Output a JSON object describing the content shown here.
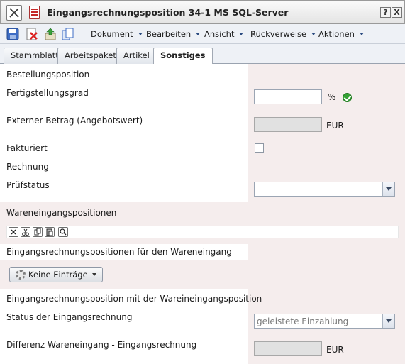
{
  "window": {
    "title": "Eingangsrechnungsposition 34-1 MS SQL-Server",
    "help_label": "?",
    "close_label": "X"
  },
  "toolbar": {
    "icons": [
      "save-icon",
      "delete-icon",
      "export-icon",
      "copy-icon"
    ],
    "menus": [
      "Dokument",
      "Bearbeiten",
      "Ansicht",
      "Rückverweise",
      "Aktionen"
    ]
  },
  "tabs": [
    {
      "label": "Stammblatt",
      "active": false
    },
    {
      "label": "Arbeitspaket",
      "active": false
    },
    {
      "label": "Artikel",
      "active": false
    },
    {
      "label": "Sonstiges",
      "active": true
    }
  ],
  "form": {
    "bestellungsposition_label": "Bestellungsposition",
    "fertigstellungsgrad": {
      "label": "Fertigstellungsgrad",
      "value": "",
      "unit": "%"
    },
    "externer_betrag": {
      "label": "Externer Betrag (Angebotswert)",
      "value": "",
      "unit": "EUR"
    },
    "fakturiert": {
      "label": "Fakturiert",
      "checked": false
    },
    "rechnung_label": "Rechnung",
    "pruefstatus": {
      "label": "Prüfstatus",
      "value": ""
    },
    "wareneingang_label": "Wareneingangspositionen",
    "grid_icons": [
      "delete-icon",
      "cut-icon",
      "copy-icon",
      "paste-icon",
      "search-icon"
    ],
    "er_positionen_label": "Eingangsrechnungspositionen für den Wareneingang",
    "keine_eintraege": "Keine Einträge",
    "er_position_we_label": "Eingangsrechnungsposition mit der Wareineingangsposition",
    "status_rechnung": {
      "label": "Status der Eingangsrechnung",
      "value": "geleistete Einzahlung"
    },
    "differenz": {
      "label": "Differenz Wareneingang - Eingangsrechnung",
      "value": "",
      "unit": "EUR"
    }
  },
  "colors": {
    "accent": "#2a4a80",
    "section_bg": "#f5eded",
    "ok_green": "#35a135"
  }
}
